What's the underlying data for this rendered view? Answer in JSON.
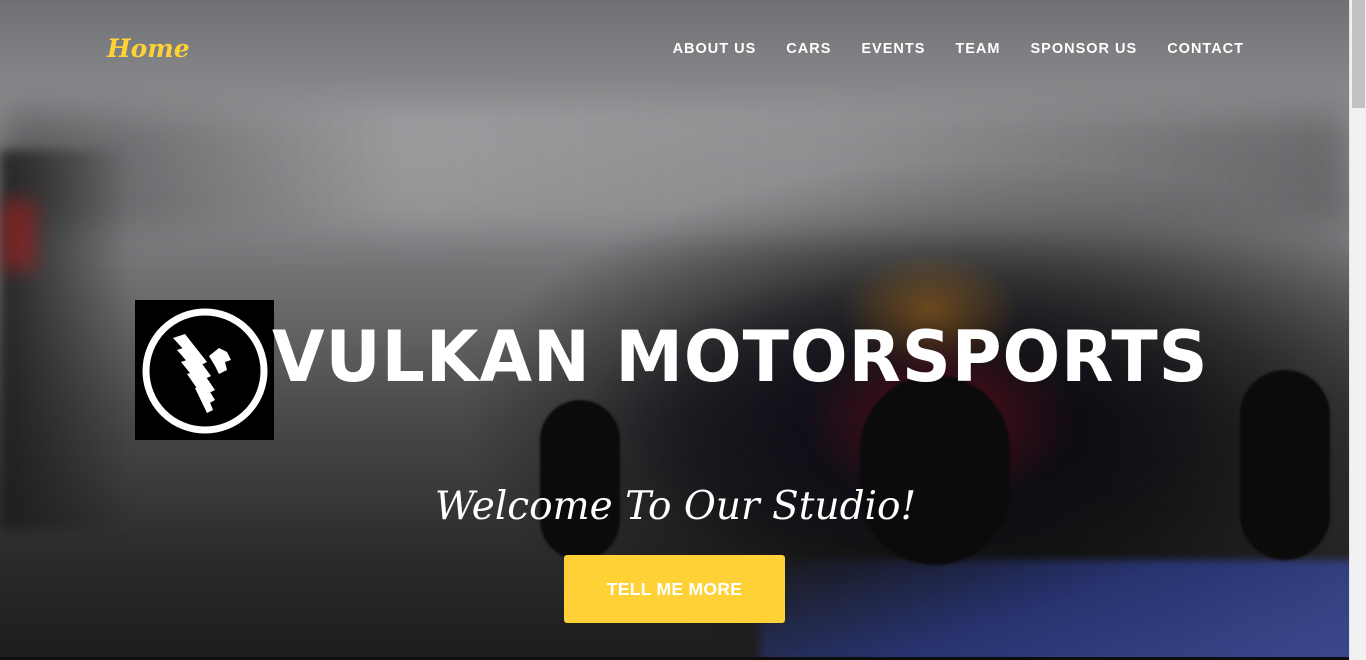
{
  "navbar": {
    "brand": "Home",
    "items": [
      {
        "label": "ABOUT US"
      },
      {
        "label": "CARS"
      },
      {
        "label": "EVENTS"
      },
      {
        "label": "TEAM"
      },
      {
        "label": "SPONSOR US"
      },
      {
        "label": "CONTACT"
      }
    ]
  },
  "hero": {
    "heading": "VULKAN MOTORSPORTS",
    "lead": "Welcome To Our Studio!",
    "cta_label": "TELL ME MORE",
    "logo_icon": "vulkan-logo-icon"
  },
  "colors": {
    "accent": "#fed136",
    "text": "#ffffff",
    "logo_bg": "#000000"
  }
}
